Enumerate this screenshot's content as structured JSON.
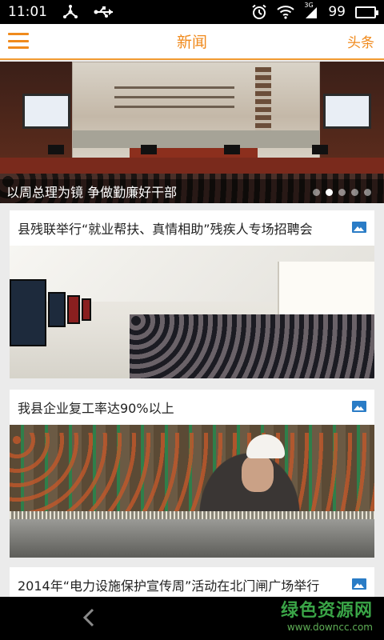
{
  "status_bar": {
    "time": "11:01",
    "left_icons": [
      "usb-tether-icon",
      "usb-icon"
    ],
    "right_icons": [
      "alarm-icon",
      "wifi-icon",
      "signal-3g-icon",
      "battery-icon"
    ],
    "signal_label": "3G",
    "battery": "99",
    "battery_level": 0.99
  },
  "app_bar": {
    "menu_icon": "hamburger-menu-icon",
    "title": "新闻",
    "right_label": "头条"
  },
  "hero": {
    "caption": "以周总理为镜   争做勤廉好干部",
    "dots_total": 5,
    "active_dot": 1
  },
  "news": [
    {
      "title": "县残联举行“就业帮扶、真情相助”残疾人专场招聘会",
      "icon": "image-icon"
    },
    {
      "title": "我县企业复工率达90%以上",
      "icon": "image-icon"
    },
    {
      "title": "2014年“电力设施保护宣传周”活动在北门闸广场举行",
      "icon": "image-icon"
    }
  ],
  "nav_bar": {
    "back_icon": "back-icon"
  },
  "watermark": {
    "main": "绿色资源网",
    "url": "www.downcc.com"
  },
  "colors": {
    "accent": "#f08a1c",
    "image_icon": "#2a7cc6",
    "battery_fill": "#56c13a",
    "watermark": "#3aa547"
  }
}
